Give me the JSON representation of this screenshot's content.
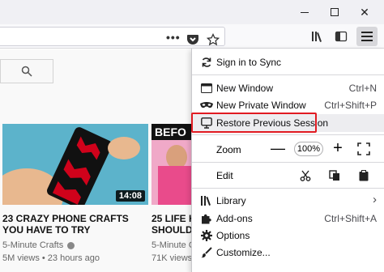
{
  "window": {
    "minimize_icon": "minimize-icon",
    "maximize_icon": "maximize-icon",
    "close_symbol": "✕"
  },
  "navbar": {
    "overflow_dots": "•••",
    "icons": [
      "pocket-icon",
      "bookmark-star-icon",
      "library-icon",
      "sidebar-icon",
      "hamburger-menu-icon"
    ]
  },
  "page": {
    "videos": [
      {
        "title_line1": "23 CRAZY PHONE CRAFTS",
        "title_line2": "YOU HAVE TO TRY",
        "channel": "5-Minute Crafts",
        "meta": "5M views • 23 hours ago",
        "duration": "14:08"
      },
      {
        "title_line1": "25 LIFE H",
        "title_line2": "SHOULD",
        "channel": "5-Minute C",
        "meta": "71K views",
        "thumb_text": "BEFO"
      }
    ]
  },
  "menu": {
    "sign_in": "Sign in to Sync",
    "new_window": {
      "label": "New Window",
      "shortcut": "Ctrl+N"
    },
    "new_private": {
      "label": "New Private Window",
      "shortcut": "Ctrl+Shift+P"
    },
    "restore": "Restore Previous Session",
    "zoom": {
      "label": "Zoom",
      "minus": "—",
      "value": "100%",
      "plus": "+"
    },
    "edit": {
      "label": "Edit"
    },
    "library": {
      "label": "Library",
      "arrow": "›"
    },
    "addons": {
      "label": "Add-ons",
      "shortcut": "Ctrl+Shift+A"
    },
    "options": {
      "label": "Options"
    },
    "customize": {
      "label": "Customize..."
    }
  },
  "colors": {
    "highlight": "#e11b22",
    "menu_bg": "#ffffff",
    "toolbar_bg": "#f9f9fb"
  }
}
